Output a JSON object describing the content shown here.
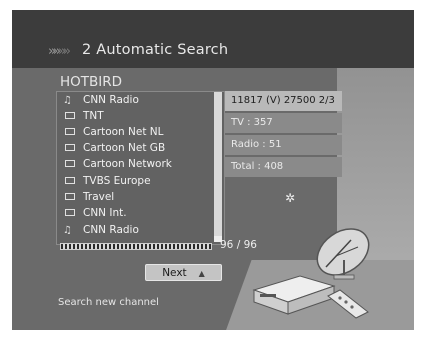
{
  "header": {
    "chevrons": "»»",
    "title": "2 Automatic Search"
  },
  "satellite": "HOTBIRD",
  "channels": [
    {
      "type": "radio",
      "name": "CNN Radio"
    },
    {
      "type": "tv",
      "name": "TNT"
    },
    {
      "type": "tv",
      "name": "Cartoon Net NL"
    },
    {
      "type": "tv",
      "name": "Cartoon Net GB"
    },
    {
      "type": "tv",
      "name": "Cartoon Network"
    },
    {
      "type": "tv",
      "name": "TVBS Europe"
    },
    {
      "type": "tv",
      "name": "Travel"
    },
    {
      "type": "tv",
      "name": "CNN Int."
    },
    {
      "type": "radio",
      "name": "CNN Radio"
    }
  ],
  "info": {
    "transponder": "11817 (V) 27500 2/3",
    "tv": "TV : 357",
    "radio": "Radio : 51",
    "total": "Total : 408"
  },
  "progress": {
    "text": "96 / 96",
    "fraction": 1.0
  },
  "next_button": {
    "label": "Next",
    "icon": "triangle-up-icon"
  },
  "footer": "Search new channel",
  "icons": {
    "tv": "tv-box-icon",
    "radio": "music-note-icon",
    "sparkle": "sparkle-icon"
  }
}
